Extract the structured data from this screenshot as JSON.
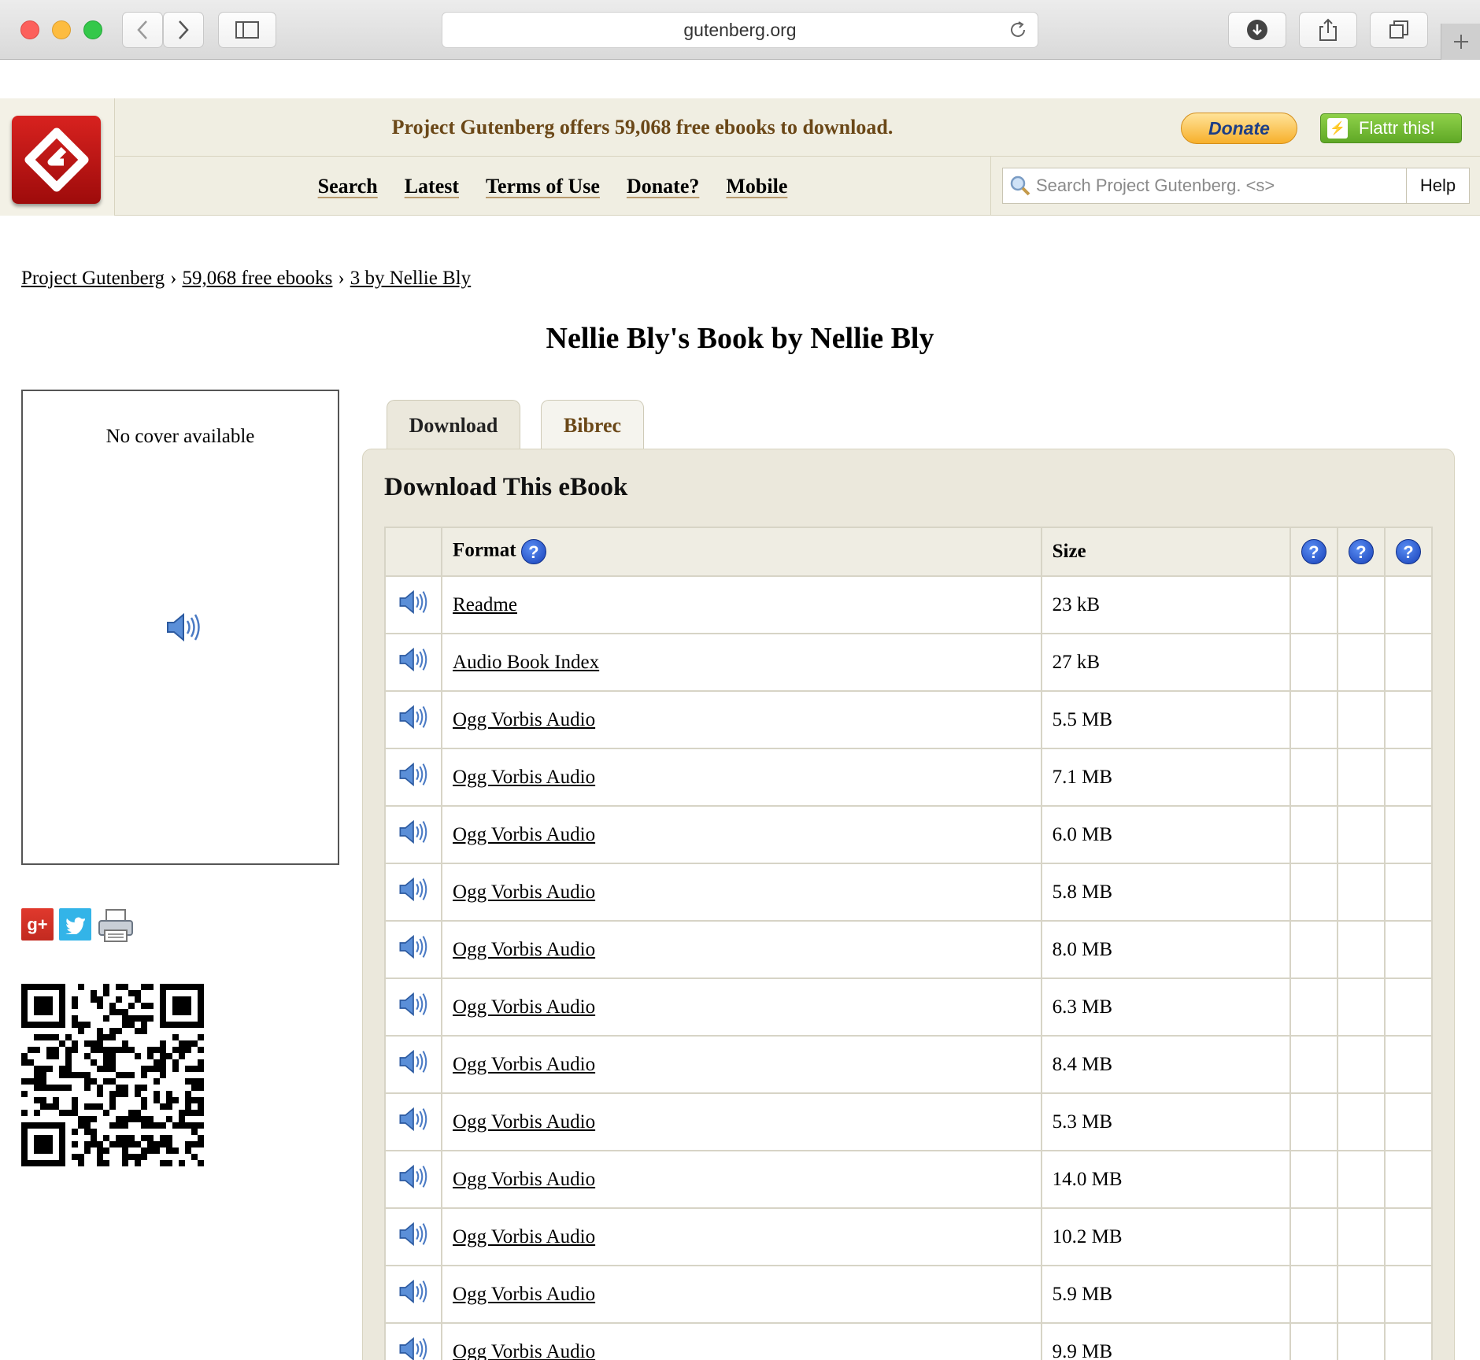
{
  "browser": {
    "url": "gutenberg.org",
    "icons": [
      "back-icon",
      "forward-icon",
      "sidebar-icon",
      "reload-icon",
      "download-icon",
      "share-icon",
      "tabs-icon",
      "new-tab-icon"
    ]
  },
  "header": {
    "offer_text": "Project Gutenberg offers 59,068 free ebooks to download.",
    "donate_label": "Donate",
    "flattr_label": "Flattr this!",
    "nav": [
      "Search",
      "Latest",
      "Terms of Use",
      "Donate?",
      "Mobile"
    ],
    "search_placeholder": "Search Project Gutenberg. <s>",
    "help_label": "Help"
  },
  "breadcrumb": [
    "Project Gutenberg",
    "59,068 free ebooks",
    "3 by Nellie Bly"
  ],
  "breadcrumb_sep": "›",
  "title": "Nellie Bly's Book by Nellie Bly",
  "cover": {
    "text": "No cover available"
  },
  "share": {
    "gplus_label": "g+"
  },
  "tabs": [
    "Download",
    "Bibrec"
  ],
  "panel": {
    "title": "Download This eBook",
    "columns": {
      "format": "Format",
      "size": "Size"
    },
    "rows": [
      {
        "format": "Readme",
        "size": "23 kB"
      },
      {
        "format": "Audio Book Index",
        "size": "27 kB"
      },
      {
        "format": "Ogg Vorbis Audio",
        "size": "5.5 MB"
      },
      {
        "format": "Ogg Vorbis Audio",
        "size": "7.1 MB"
      },
      {
        "format": "Ogg Vorbis Audio",
        "size": "6.0 MB"
      },
      {
        "format": "Ogg Vorbis Audio",
        "size": "5.8 MB"
      },
      {
        "format": "Ogg Vorbis Audio",
        "size": "8.0 MB"
      },
      {
        "format": "Ogg Vorbis Audio",
        "size": "6.3 MB"
      },
      {
        "format": "Ogg Vorbis Audio",
        "size": "8.4 MB"
      },
      {
        "format": "Ogg Vorbis Audio",
        "size": "5.3 MB"
      },
      {
        "format": "Ogg Vorbis Audio",
        "size": "14.0 MB"
      },
      {
        "format": "Ogg Vorbis Audio",
        "size": "10.2 MB"
      },
      {
        "format": "Ogg Vorbis Audio",
        "size": "5.9 MB"
      },
      {
        "format": "Ogg Vorbis Audio",
        "size": "9.9 MB"
      }
    ]
  },
  "colors": {
    "accent_brown": "#6b4818",
    "header_bg": "#f0eee2",
    "panel_bg": "#ebe8dc",
    "logo_red": "#c0151a"
  }
}
